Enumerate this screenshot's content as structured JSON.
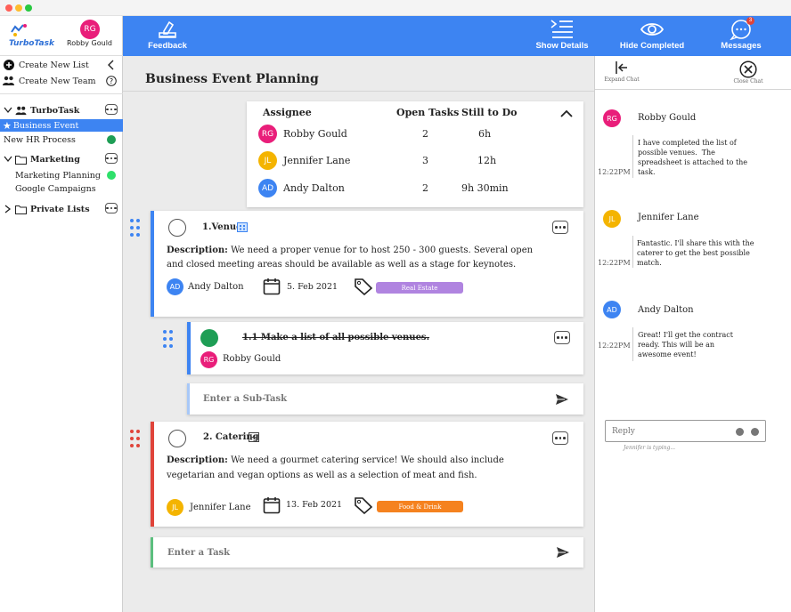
{
  "window": {
    "dots": [
      "#ff5f57",
      "#febc2e",
      "#28c840"
    ]
  },
  "sidebar": {
    "logo": "TurboTask",
    "user": {
      "initials": "RG",
      "name": "Robby Gould"
    },
    "actions": [
      {
        "label": "Create New List",
        "icon": "plus-circle-icon"
      },
      {
        "label": "Create New Team",
        "icon": "team-icon"
      }
    ],
    "groups": [
      {
        "label": "TurboTask"
      },
      {
        "label": "Marketing"
      },
      {
        "label": "Private Lists"
      }
    ],
    "items": [
      {
        "label": "Business Event",
        "active": true
      },
      {
        "label": "New HR Process",
        "status_color": "#1e9e55"
      },
      {
        "label": "Marketing Planning",
        "status_color": "#2ee06a"
      },
      {
        "label": "Google Campaigns"
      }
    ]
  },
  "topbar": {
    "feedback": "Feedback",
    "show_details": "Show Details",
    "hide_completed": "Hide Completed",
    "messages": "Messages",
    "messages_badge": "3"
  },
  "main": {
    "title": "Business Event Planning",
    "assignee_table": {
      "headers": [
        "Assignee",
        "Open Tasks",
        "Still to Do"
      ],
      "rows": [
        {
          "initials": "RG",
          "name": "Robby Gould",
          "open": "2",
          "todo": "6h",
          "color": "#e91e7a"
        },
        {
          "initials": "JL",
          "name": "Jennifer Lane",
          "open": "3",
          "todo": "12h",
          "color": "#f4b400"
        },
        {
          "initials": "AD",
          "name": "Andy Dalton",
          "open": "2",
          "todo": "9h 30min",
          "color": "#3d84f2"
        }
      ]
    },
    "tasks": [
      {
        "title": "1.Venue",
        "description_label": "Description:",
        "description_line1": "We need a proper venue for to host 250 - 300 guests. Several open",
        "description_line2": "and closed meeting areas should be available as well as a stage for keynotes.",
        "assignee_initials": "AD",
        "assignee": "Andy Dalton",
        "date": "5. Feb 2021",
        "tag": "Real Estate",
        "tag_color": "#b084e0",
        "accent": "#3d84f2"
      },
      {
        "title": "2. Catering",
        "description_label": "Description:",
        "description_line1": "We need a gourmet catering service! We should also include",
        "description_line2": "vegetarian and vegan options as well as a selection of meat and fish.",
        "assignee_initials": "JL",
        "assignee": "Jennifer Lane",
        "date": "13. Feb 2021",
        "tag": "Food & Drink",
        "tag_color": "#f5821f",
        "accent": "#e0443a"
      }
    ],
    "subtask": {
      "title": "1.1 Make a list of all possible venues.",
      "assignee_initials": "RG",
      "assignee": "Robby Gould",
      "done_color": "#1e9e55"
    },
    "subtask_input": "Enter a Sub-Task",
    "task_input": "Enter a Task"
  },
  "chat": {
    "expand": "Expand Chat",
    "close": "Close Chat",
    "messages": [
      {
        "initials": "RG",
        "name": "Robby Gould",
        "color": "#e91e7a",
        "time": "12:22PM",
        "text": "I have completed the list of\npossible venues.  The\nspreadsheet is attached to the\ntask."
      },
      {
        "initials": "JL",
        "name": "Jennifer Lane",
        "color": "#f4b400",
        "time": "12:22PM",
        "text": "Fantastic. I'll share this with the\ncaterer to get the best possible\nmatch."
      },
      {
        "initials": "AD",
        "name": "Andy Dalton",
        "color": "#3d84f2",
        "time": "12:22PM",
        "text": "Great! I'll get the contract\nready. This will be an\nawesome event!"
      }
    ],
    "reply_placeholder": "Reply",
    "typing": "Jennifer  is typing..."
  }
}
